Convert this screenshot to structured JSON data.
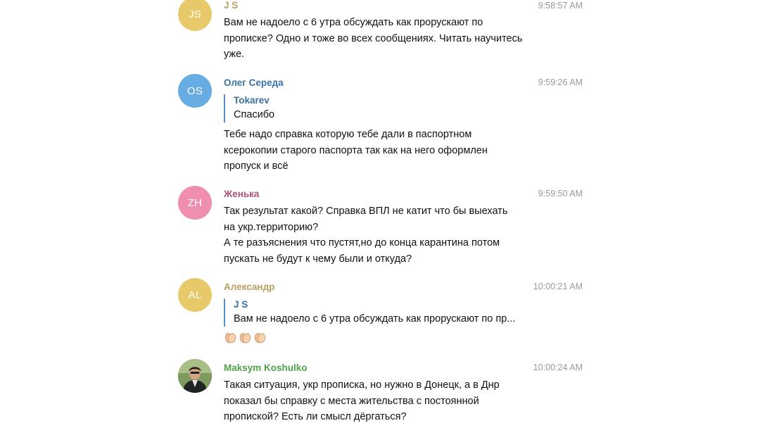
{
  "messages": [
    {
      "initials": "JS",
      "avatar_color": "#e8c96a",
      "author": "J S",
      "author_color": "#b9a062",
      "time": "9:58:57 AM",
      "lines": [
        "Вам не надоело с 6 утра обсуждать как прорускают по",
        "прописке? Одно и тоже во всех сообщениях. Читать научитесь",
        "уже."
      ]
    },
    {
      "initials": "OS",
      "avatar_color": "#67ade4",
      "author": "Олег Середа",
      "author_color": "#3a73a8",
      "time": "9:59:26 AM",
      "reply": {
        "author": "Tokarev",
        "text": "Спасибо"
      },
      "lines": [
        "Тебе надо справка которую тебе дали в паспортном",
        "ксерокопии старого паспорта так как на него оформлен",
        "пропуск и всё"
      ]
    },
    {
      "initials": "ZH",
      "avatar_color": "#f08eb0",
      "author": "Женька",
      "author_color": "#b1517d",
      "time": "9:59:50 AM",
      "lines": [
        "Так результат какой? Справка ВПЛ не катит что бы выехать",
        "на укр.территорию?",
        "А те разъяснения что пустят,но до конца карантина потом",
        "пускать не будут к чему были и откуда?"
      ]
    },
    {
      "initials": "AL",
      "avatar_color": "#e8c96a",
      "author": "Александр",
      "author_color": "#b9a062",
      "time": "10:00:21 AM",
      "reply": {
        "author": "J S",
        "text": "Вам не надоело с 6 утра обсуждать как прорускают по пр..."
      },
      "emoji": "clapping-hands-x3"
    },
    {
      "initials": "",
      "author": "Maksym Koshulko",
      "author_color": "#4fa24b",
      "time": "10:00:24 AM",
      "lines": [
        "Такая ситуация, укр прописка, но нужно в Донецк, а в Днр",
        "показал бы справку с места жительства с постоянной",
        "пропиской? Есть ли смысл дёргаться?"
      ]
    }
  ]
}
